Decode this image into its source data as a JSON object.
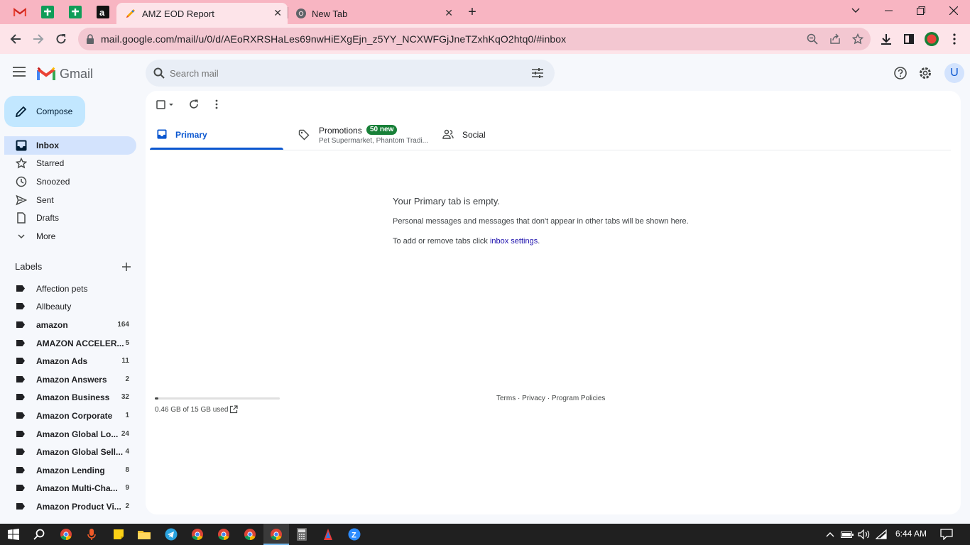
{
  "browser": {
    "tabs": [
      {
        "title": "AMZ EOD Report"
      },
      {
        "title": "New Tab"
      }
    ],
    "url": "mail.google.com/mail/u/0/d/AEoRXRSHaLes69nwHiEXgEjn_z5YY_NCXWFGjJneTZxhKqO2htq0/#inbox"
  },
  "gmail": {
    "logo_text": "Gmail",
    "search_placeholder": "Search mail",
    "avatar_letter": "U",
    "compose_label": "Compose",
    "nav": [
      {
        "label": "Inbox",
        "icon": "inbox-icon"
      },
      {
        "label": "Starred",
        "icon": "star-icon"
      },
      {
        "label": "Snoozed",
        "icon": "clock-icon"
      },
      {
        "label": "Sent",
        "icon": "send-icon"
      },
      {
        "label": "Drafts",
        "icon": "draft-icon"
      },
      {
        "label": "More",
        "icon": "chevron-down-icon"
      }
    ],
    "labels_heading": "Labels",
    "labels": [
      {
        "name": "Affection pets",
        "count": "",
        "bold": false
      },
      {
        "name": "Allbeauty",
        "count": "",
        "bold": false
      },
      {
        "name": "amazon",
        "count": "164",
        "bold": true
      },
      {
        "name": "AMAZON ACCELER...",
        "count": "5",
        "bold": true
      },
      {
        "name": "Amazon Ads",
        "count": "11",
        "bold": true
      },
      {
        "name": "Amazon Answers",
        "count": "2",
        "bold": true
      },
      {
        "name": "Amazon Business",
        "count": "32",
        "bold": true
      },
      {
        "name": "Amazon Corporate",
        "count": "1",
        "bold": true
      },
      {
        "name": "Amazon Global Lo...",
        "count": "24",
        "bold": true
      },
      {
        "name": "Amazon Global Sell...",
        "count": "4",
        "bold": true
      },
      {
        "name": "Amazon Lending",
        "count": "8",
        "bold": true
      },
      {
        "name": "Amazon Multi-Cha...",
        "count": "9",
        "bold": true
      },
      {
        "name": "Amazon Product Vi...",
        "count": "2",
        "bold": true
      }
    ],
    "tabs": {
      "primary": "Primary",
      "promotions": "Promotions",
      "promotions_badge": "50 new",
      "promotions_sub": "Pet Supermarket, Phantom Tradi...",
      "social": "Social"
    },
    "empty": {
      "title": "Your Primary tab is empty.",
      "line1": "Personal messages and messages that don't appear in other tabs will be shown here.",
      "line2_prefix": "To add or remove tabs click ",
      "line2_link": "inbox settings",
      "line2_suffix": "."
    },
    "storage": {
      "text": "0.46 GB of 15 GB used",
      "fraction": 0.03
    },
    "footer": {
      "terms": "Terms",
      "privacy": "Privacy",
      "policies": "Program Policies",
      "sep": " · "
    }
  },
  "taskbar": {
    "time": "6:44 AM"
  },
  "colors": {
    "tabbar": "#f8b5c2",
    "toolbar": "#fde4e9",
    "accent": "#0b57d0",
    "selected_nav": "#d3e3fd",
    "compose": "#c2e7ff",
    "badge": "#188038",
    "taskbar": "#202020"
  }
}
